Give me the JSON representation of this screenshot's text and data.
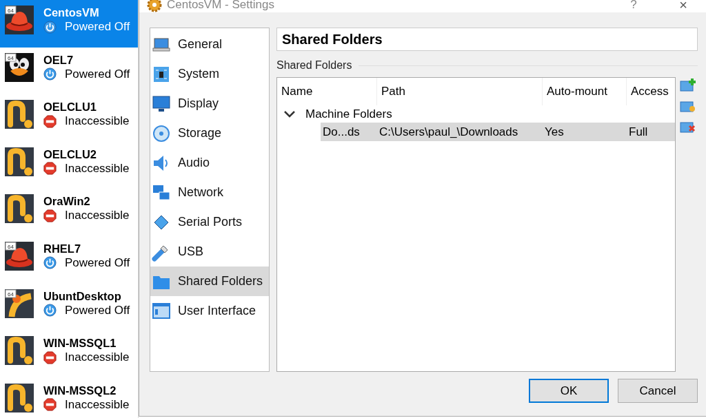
{
  "vm_list": [
    {
      "name": "CentosVM",
      "state": {
        "text": "Powered Off",
        "kind": "off"
      },
      "logo": {
        "kind": "redhat",
        "badge": "64"
      },
      "selected": true
    },
    {
      "name": "OEL7",
      "state": {
        "text": "Powered Off",
        "kind": "off"
      },
      "logo": {
        "kind": "penguin",
        "badge": "64"
      },
      "selected": false
    },
    {
      "name": "OELCLU1",
      "state": {
        "text": "Inaccessible",
        "kind": "inaccessible"
      },
      "logo": {
        "kind": "generic"
      },
      "selected": false
    },
    {
      "name": "OELCLU2",
      "state": {
        "text": "Inaccessible",
        "kind": "inaccessible"
      },
      "logo": {
        "kind": "generic"
      },
      "selected": false
    },
    {
      "name": "OraWin2",
      "state": {
        "text": "Inaccessible",
        "kind": "inaccessible"
      },
      "logo": {
        "kind": "generic"
      },
      "selected": false
    },
    {
      "name": "RHEL7",
      "state": {
        "text": "Powered Off",
        "kind": "off"
      },
      "logo": {
        "kind": "redhat",
        "badge": "64"
      },
      "selected": false
    },
    {
      "name": "UbuntDesktop",
      "state": {
        "text": "Powered Off",
        "kind": "off"
      },
      "logo": {
        "kind": "ubuntu",
        "badge": "64"
      },
      "selected": false
    },
    {
      "name": "WIN-MSSQL1",
      "state": {
        "text": "Inaccessible",
        "kind": "inaccessible"
      },
      "logo": {
        "kind": "generic"
      },
      "selected": false
    },
    {
      "name": "WIN-MSSQL2",
      "state": {
        "text": "Inaccessible",
        "kind": "inaccessible"
      },
      "logo": {
        "kind": "generic"
      },
      "selected": false
    }
  ],
  "window": {
    "title": "CentosVM - Settings",
    "help": "?",
    "close": "×"
  },
  "sidebar": {
    "items": [
      {
        "label": "General",
        "kind": "general",
        "selected": false
      },
      {
        "label": "System",
        "kind": "system",
        "selected": false
      },
      {
        "label": "Display",
        "kind": "display",
        "selected": false
      },
      {
        "label": "Storage",
        "kind": "storage",
        "selected": false
      },
      {
        "label": "Audio",
        "kind": "audio",
        "selected": false
      },
      {
        "label": "Network",
        "kind": "network",
        "selected": false
      },
      {
        "label": "Serial Ports",
        "kind": "serial",
        "selected": false
      },
      {
        "label": "USB",
        "kind": "usb",
        "selected": false
      },
      {
        "label": "Shared Folders",
        "kind": "folder",
        "selected": true
      },
      {
        "label": "User Interface",
        "kind": "ui",
        "selected": false
      }
    ]
  },
  "page_title": "Shared Folders",
  "group_label": "Shared Folders",
  "table": {
    "columns": [
      "Name",
      "Path",
      "Auto-mount",
      "Access"
    ],
    "groups": [
      {
        "label": "Machine Folders",
        "expanded": true,
        "rows": [
          {
            "cells": [
              "Do...ds",
              "C:\\Users\\paul_\\Downloads",
              "Yes",
              "Full"
            ],
            "selected": true
          }
        ]
      }
    ]
  },
  "side_tools": [
    {
      "kind": "add"
    },
    {
      "kind": "edit"
    },
    {
      "kind": "remove"
    }
  ],
  "buttons": [
    {
      "label": "OK",
      "default": true
    },
    {
      "label": "Cancel",
      "default": false
    }
  ]
}
